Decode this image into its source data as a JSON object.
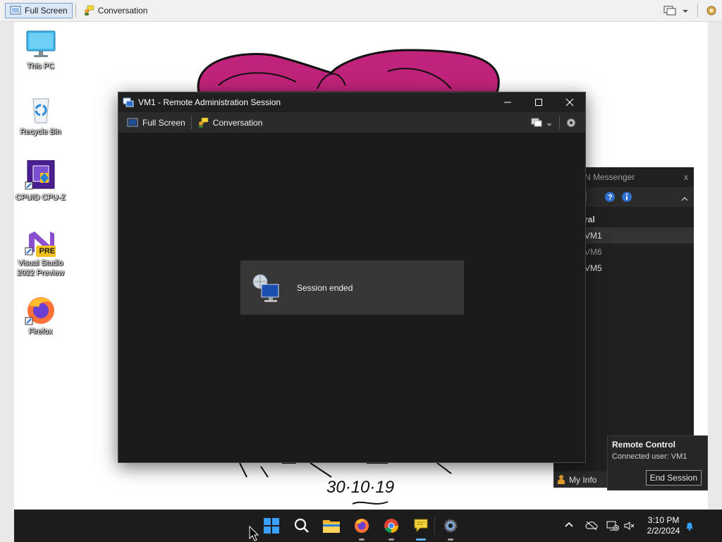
{
  "host_toolbar": {
    "full_screen_label": "Full Screen",
    "conversation_label": "Conversation"
  },
  "desktop": {
    "icons": [
      {
        "label": "This PC",
        "icon": "monitor-icon"
      },
      {
        "label": "Recycle Bin",
        "icon": "recycle-bin-icon"
      },
      {
        "label": "CPUID CPU-Z",
        "icon": "cpu-z-icon"
      },
      {
        "label": "Visual Studio 2022 Preview",
        "icon": "visual-studio-icon",
        "badge": "PRE"
      },
      {
        "label": "Firefox",
        "icon": "firefox-icon"
      }
    ],
    "wallpaper_text": {
      "date": "30·10·19"
    }
  },
  "session_window": {
    "title": "VM1 - Remote Administration Session",
    "toolbar": {
      "full_screen_label": "Full Screen",
      "conversation_label": "Conversation"
    },
    "status_message": "Session ended"
  },
  "messenger": {
    "title": "tros LAN Messenger",
    "close_glyph": "x",
    "group_name": "General",
    "contacts": [
      {
        "name": "VM1",
        "status_color": "#e8a030",
        "selected": true
      },
      {
        "name": "VM6",
        "status_color": "#e8a030",
        "selected": false
      },
      {
        "name": "VM5",
        "status_color": "#e04848",
        "selected": false
      }
    ],
    "my_info_label": "My Info"
  },
  "remote_control_popup": {
    "title": "Remote Control",
    "connected_text": "Connected user: VM1",
    "end_button_label": "End Session"
  },
  "taskbar": {
    "time": "3:10 PM",
    "date": "2/2/2024"
  },
  "colors": {
    "ribbon": "#c0237a",
    "accent_blue": "#0078d4"
  }
}
